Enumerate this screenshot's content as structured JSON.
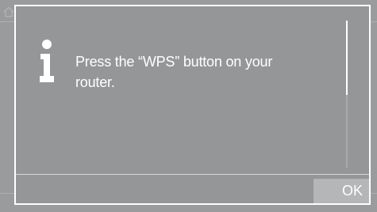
{
  "background": {
    "home_icon": "home-icon"
  },
  "dialog": {
    "icon": "info-icon",
    "message": "Press the “WPS” button on your router.",
    "ok_label": "OK",
    "scroll_position": 0.0
  },
  "colors": {
    "background": "#9a9b9d",
    "dialog_background": "#959698",
    "border": "#ffffff",
    "text": "#ffffff",
    "button": "#b5b6b8"
  }
}
